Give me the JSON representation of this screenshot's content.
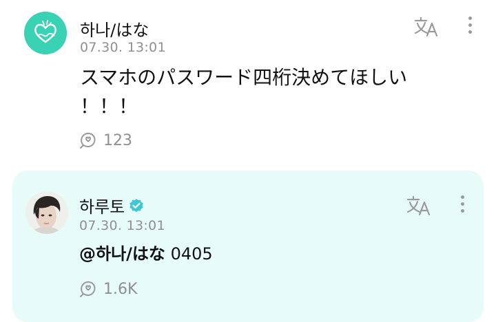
{
  "post": {
    "author": "하나/はな",
    "timestamp": "07.30. 13:01",
    "body": "スマホのパスワード四桁決めてほしい\n！！！",
    "reaction_count": "123",
    "icons": {
      "translate": "translate-icon",
      "more": "kebab-menu-icon",
      "reaction": "reaction-icon"
    }
  },
  "reply": {
    "author": "하루토",
    "verified": true,
    "timestamp": "07.30. 13:01",
    "mention": "@하나/はな",
    "text": " 0405",
    "reaction_count": "1.6K",
    "icons": {
      "verified": "verified-badge-icon",
      "translate": "translate-icon",
      "more": "kebab-menu-icon",
      "reaction": "reaction-icon"
    }
  },
  "colors": {
    "fan_avatar": "#3ad2b4",
    "reply_background": "#e7fbf8",
    "verified_badge": "#3bc7d6",
    "meta_text": "#8f8f8f",
    "icon_gray": "#9a9a9a"
  }
}
